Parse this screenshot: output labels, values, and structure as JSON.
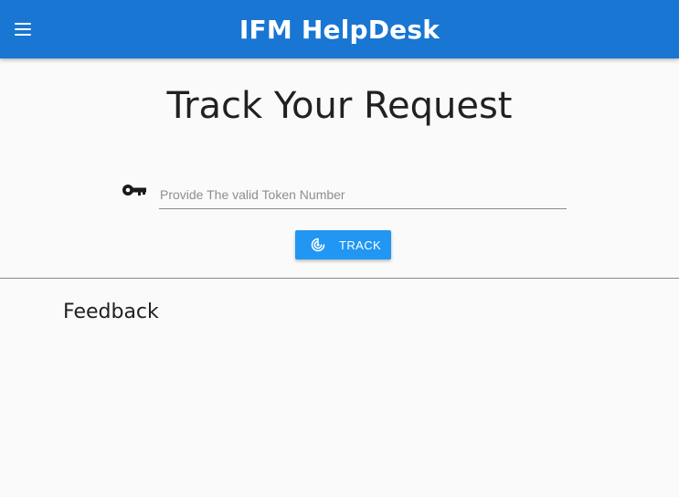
{
  "header": {
    "title": "IFM HelpDesk",
    "menu_icon": "hamburger-menu-icon",
    "background_color": "#1976d2"
  },
  "main": {
    "title": "Track Your Request",
    "token_field": {
      "icon": "key-icon",
      "placeholder": "Provide The valid Token Number",
      "value": ""
    },
    "track_button": {
      "icon": "radar-track-icon",
      "label": "TRACK",
      "color": "#2196f3"
    }
  },
  "feedback": {
    "heading": "Feedback"
  }
}
